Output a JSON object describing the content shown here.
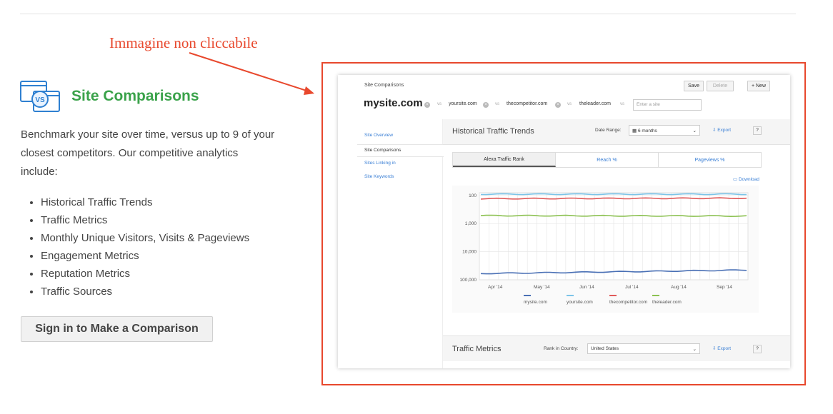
{
  "annotation": "Immagine non cliccabile",
  "feature": {
    "title": "Site Comparisons",
    "description": "Benchmark your site over time, versus up to 9 of your closest competitors. Our competitive analytics include:",
    "bullets": [
      "Historical Traffic Trends",
      "Traffic Metrics",
      "Monthly Unique Visitors, Visits & Pageviews",
      "Engagement Metrics",
      "Reputation Metrics",
      "Traffic Sources"
    ],
    "signin_label": "Sign in to Make a Comparison",
    "icon": "vs-windows-icon"
  },
  "colors": {
    "accent_green": "#3aa24a",
    "annotation_red": "#e8482d",
    "link_blue": "#3a7fd5"
  },
  "screenshot": {
    "breadcrumb": "Site Comparisons",
    "save": "Save",
    "delete": "Delete",
    "new": "+ New",
    "main_site": "mysite.com",
    "vs": "vs",
    "competitors": [
      "yoursite.com",
      "thecompetitor.com",
      "theleader.com"
    ],
    "enter_placeholder": "Enter a site",
    "nav": [
      "Site Overview",
      "Site Comparisons",
      "Sites Linking in",
      "Site Keywords"
    ],
    "section_title": "Historical Traffic Trends",
    "date_range_label": "Date Range:",
    "date_range_value": "6 months",
    "export": "Export",
    "help": "?",
    "tabs": [
      "Alexa Traffic Rank",
      "Reach %",
      "Pageviews %"
    ],
    "download": "Download",
    "footer_title": "Traffic Metrics",
    "rank_label": "Rank in Country:",
    "rank_value": "United States"
  },
  "chart_data": {
    "type": "line",
    "y_scale": "log, inverted",
    "yticks": [
      "100",
      "1,000",
      "10,000",
      "100,000"
    ],
    "ylim": [
      100000,
      80
    ],
    "xticks": [
      "Apr '14",
      "May '14",
      "Jun '14",
      "Jul '14",
      "Aug '14",
      "Sep '14"
    ],
    "grid": true,
    "legend_position": "bottom",
    "series": [
      {
        "name": "mysite.com",
        "color": "#4a70b5",
        "start": 60000,
        "end": 45000
      },
      {
        "name": "yoursite.com",
        "color": "#7cc4e8",
        "start": 90,
        "end": 90
      },
      {
        "name": "thecompetitor.com",
        "color": "#e05a5a",
        "start": 130,
        "end": 125
      },
      {
        "name": "theleader.com",
        "color": "#8cc152",
        "start": 520,
        "end": 540
      }
    ]
  }
}
